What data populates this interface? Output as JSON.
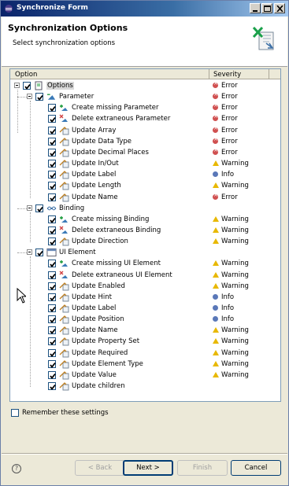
{
  "window": {
    "title": "Synchronize Form",
    "icon": "eclipse-icon"
  },
  "header": {
    "title": "Synchronization Options",
    "subtitle": "Select synchronization options",
    "image": "synchronize-wizard-icon"
  },
  "tree": {
    "columns": {
      "option": "Option",
      "severity": "Severity"
    },
    "root": {
      "label": "Options",
      "severity": "Error",
      "severity_type": "error"
    },
    "groups": [
      {
        "label": "Parameter",
        "severity": "Error",
        "severity_type": "error",
        "items": [
          {
            "label": "Create missing Parameter",
            "severity": "Error",
            "severity_type": "error"
          },
          {
            "label": "Delete extraneous Parameter",
            "severity": "Error",
            "severity_type": "error"
          },
          {
            "label": "Update Array",
            "severity": "Error",
            "severity_type": "error"
          },
          {
            "label": "Update Data Type",
            "severity": "Error",
            "severity_type": "error"
          },
          {
            "label": "Update Decimal Places",
            "severity": "Error",
            "severity_type": "error"
          },
          {
            "label": "Update In/Out",
            "severity": "Warning",
            "severity_type": "warning"
          },
          {
            "label": "Update Label",
            "severity": "Info",
            "severity_type": "info"
          },
          {
            "label": "Update Length",
            "severity": "Warning",
            "severity_type": "warning"
          },
          {
            "label": "Update Name",
            "severity": "Error",
            "severity_type": "error"
          }
        ]
      },
      {
        "label": "Binding",
        "severity": "",
        "severity_type": "",
        "items": [
          {
            "label": "Create missing Binding",
            "severity": "Warning",
            "severity_type": "warning"
          },
          {
            "label": "Delete extraneous Binding",
            "severity": "Warning",
            "severity_type": "warning"
          },
          {
            "label": "Update Direction",
            "severity": "Warning",
            "severity_type": "warning"
          }
        ]
      },
      {
        "label": "UI Element",
        "severity": "",
        "severity_type": "",
        "items": [
          {
            "label": "Create missing UI Element",
            "severity": "Warning",
            "severity_type": "warning"
          },
          {
            "label": "Delete extraneous UI Element",
            "severity": "Warning",
            "severity_type": "warning"
          },
          {
            "label": "Update Enabled",
            "severity": "Warning",
            "severity_type": "warning"
          },
          {
            "label": "Update Hint",
            "severity": "Info",
            "severity_type": "info"
          },
          {
            "label": "Update Label",
            "severity": "Info",
            "severity_type": "info"
          },
          {
            "label": "Update Position",
            "severity": "Info",
            "severity_type": "info"
          },
          {
            "label": "Update Name",
            "severity": "Warning",
            "severity_type": "warning"
          },
          {
            "label": "Update Property Set",
            "severity": "Warning",
            "severity_type": "warning"
          },
          {
            "label": "Update Required",
            "severity": "Warning",
            "severity_type": "warning"
          },
          {
            "label": "Update Element Type",
            "severity": "Warning",
            "severity_type": "warning"
          },
          {
            "label": "Update Value",
            "severity": "Warning",
            "severity_type": "warning"
          },
          {
            "label": "Update children",
            "severity": "",
            "severity_type": ""
          }
        ]
      }
    ]
  },
  "remember": {
    "label": "Remember these settings",
    "checked": false
  },
  "buttons": {
    "back": "< Back",
    "next": "Next >",
    "finish": "Finish",
    "cancel": "Cancel",
    "help": "?"
  },
  "colors": {
    "error": "#d05050",
    "warning": "#e8b800",
    "info": "#5a78b8",
    "title_bar": "#0a246a"
  }
}
